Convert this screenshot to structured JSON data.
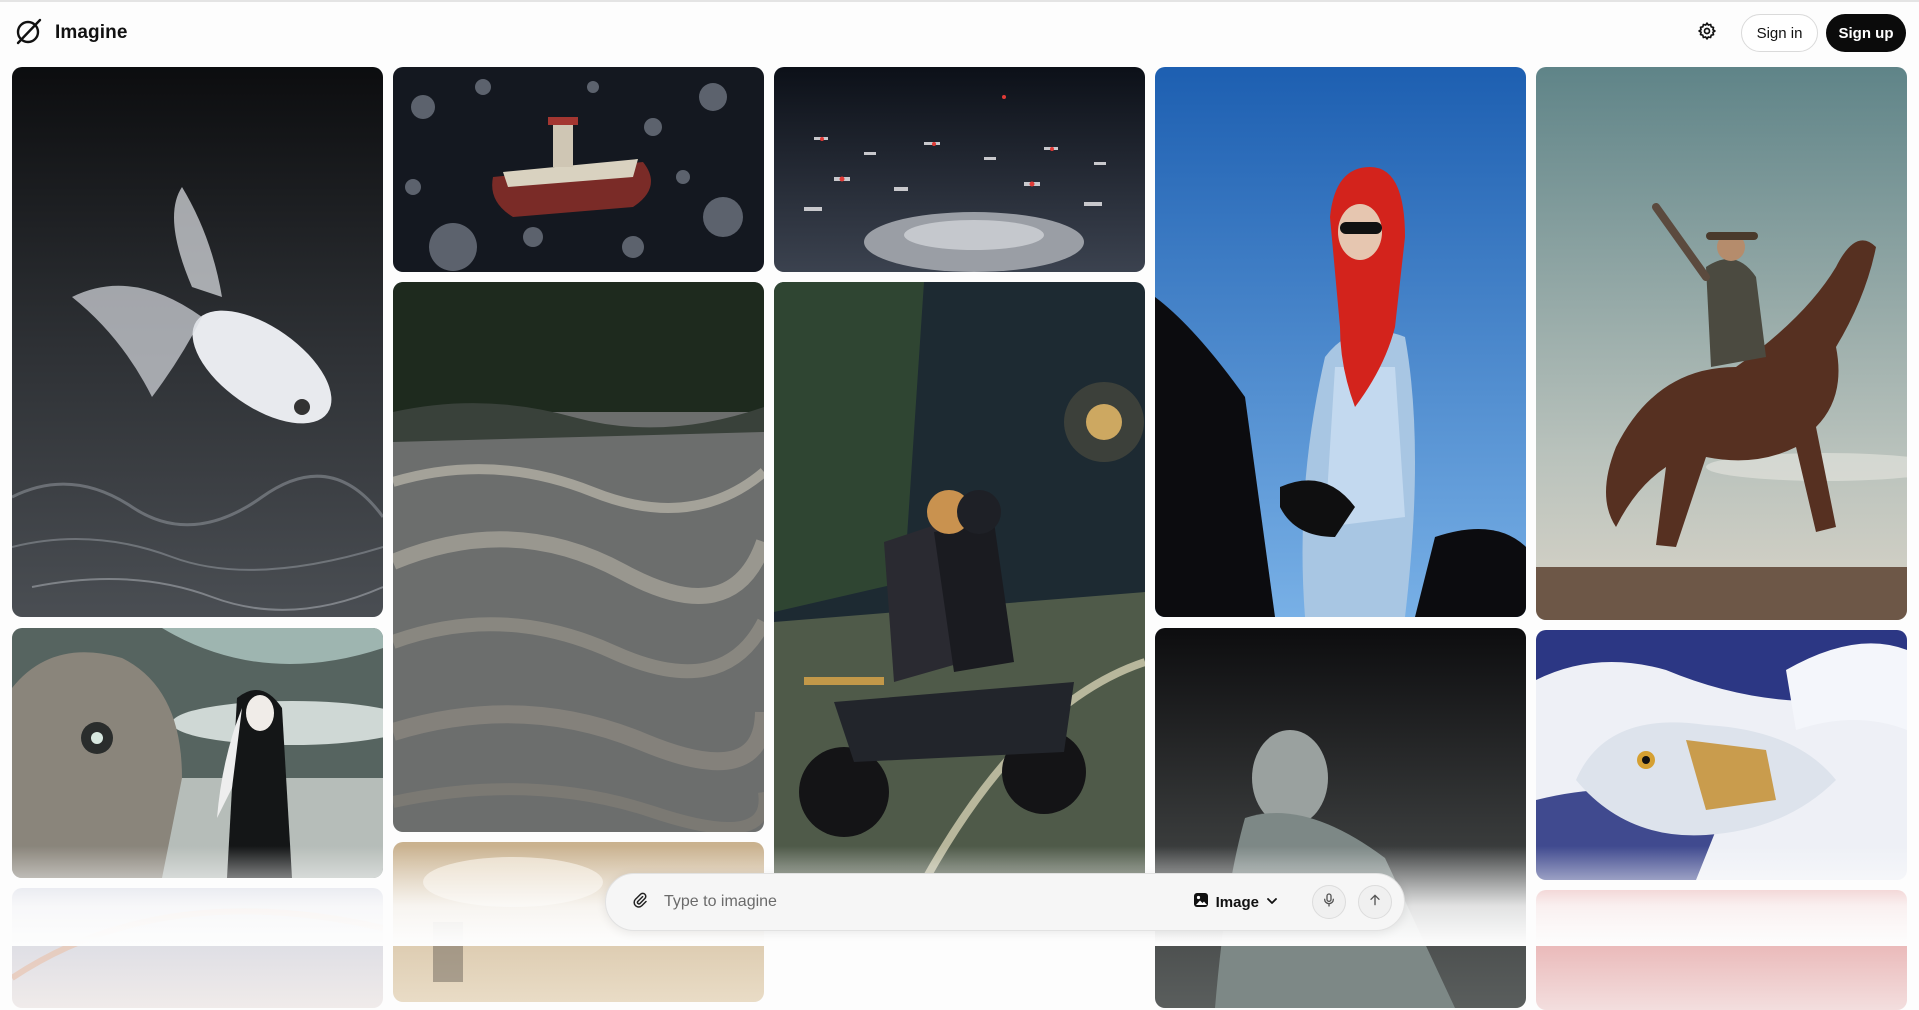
{
  "app": {
    "brand": "Imagine"
  },
  "header": {
    "settings_icon": "gear-icon",
    "signin_label": "Sign in",
    "signup_label": "Sign up"
  },
  "composer": {
    "placeholder": "Type to imagine",
    "mode_label": "Image",
    "icons": [
      "paperclip-icon",
      "image-icon",
      "chevron-down-icon",
      "microphone-icon",
      "arrow-up-icon"
    ]
  },
  "gallery": {
    "tiles": [
      {
        "subject": "translucent-fish",
        "colors": [
          "#0e0f11",
          "#55595f",
          "#e4e6ea"
        ]
      },
      {
        "subject": "alien-creature-and-woman",
        "colors": [
          "#3d4a46",
          "#8a8d86",
          "#d9e2df"
        ]
      },
      {
        "subject": "rainbow-sky",
        "colors": [
          "#d9dbe6",
          "#efe9e8"
        ]
      },
      {
        "subject": "ship-in-asteroid-field",
        "colors": [
          "#10141c",
          "#4f5560",
          "#b4403a"
        ]
      },
      {
        "subject": "rushing-river",
        "colors": [
          "#1f2a1f",
          "#56595b",
          "#9b9489"
        ]
      },
      {
        "subject": "sunset-clouds",
        "colors": [
          "#b7a890",
          "#e8d5b5"
        ]
      },
      {
        "subject": "spaceship-fleet",
        "colors": [
          "#0d1119",
          "#3a414d",
          "#c53030"
        ]
      },
      {
        "subject": "pixel-art-motorcycle",
        "colors": [
          "#1c2a2e",
          "#4d5e4c",
          "#e6b168"
        ]
      },
      {
        "subject": "woman-in-red-scarf-on-horse",
        "colors": [
          "#1f62b4",
          "#6ea6df",
          "#d4241e"
        ]
      },
      {
        "subject": "man-looking-up",
        "colors": [
          "#0f0f11",
          "#3b3d3e",
          "#9aa3a0"
        ]
      },
      {
        "subject": "cowboy-on-rearing-horse",
        "colors": [
          "#6c8c8f",
          "#bcc3bd",
          "#5a3222"
        ]
      },
      {
        "subject": "crystal-dragon",
        "colors": [
          "#e9ecf6",
          "#2f3a8a",
          "#cf9a2f"
        ]
      },
      {
        "subject": "pink-abstract",
        "colors": [
          "#e7a9a9",
          "#f3dcdc"
        ]
      }
    ]
  }
}
